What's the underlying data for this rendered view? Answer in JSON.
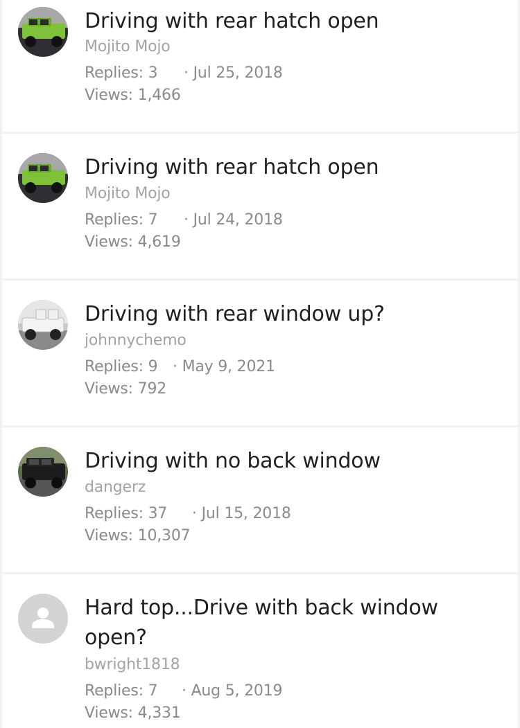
{
  "threads": [
    {
      "title": "Driving with rear hatch open",
      "author": "Mojito Mojo",
      "replies_label": "Replies: 3",
      "date": "· Jul 25, 2018",
      "views_label": "Views: 1,466",
      "avatar": "green-jeep-photo"
    },
    {
      "title": "Driving with rear hatch open",
      "author": "Mojito Mojo",
      "replies_label": "Replies: 7",
      "date": "· Jul 24, 2018",
      "views_label": "Views: 4,619",
      "avatar": "green-jeep-photo"
    },
    {
      "title": "Driving with rear window up?",
      "author": "johnnychemo",
      "replies_label": "Replies: 9",
      "date": "· May 9, 2021",
      "views_label": "Views: 792",
      "avatar": "white-jeep-photo"
    },
    {
      "title": "Driving with no back window",
      "author": "dangerz",
      "replies_label": "Replies: 37",
      "date": "· Jul 15, 2018",
      "views_label": "Views: 10,307",
      "avatar": "black-jeep-photo"
    },
    {
      "title": "Hard top...Drive with back window open?",
      "author": "bwright1818",
      "replies_label": "Replies: 7",
      "date": "· Aug 5, 2019",
      "views_label": "Views: 4,331",
      "avatar": "default-user-icon"
    }
  ],
  "colors": {
    "title": "#1f1f1f",
    "author": "#a3a3a3",
    "meta": "#8a8a8a",
    "background": "#f2f2f2",
    "card": "#ffffff",
    "jeep_green": "#7ec23a",
    "placeholder_avatar": "#d3d3d3"
  }
}
